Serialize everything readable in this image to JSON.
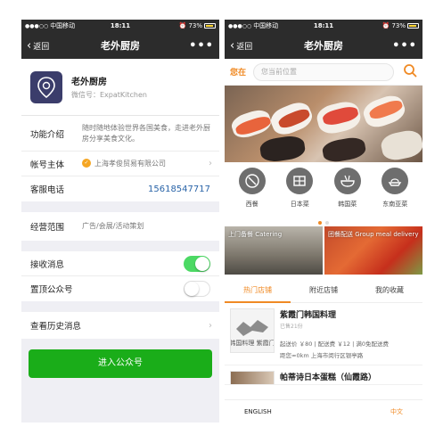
{
  "status": {
    "signal": "●●●○○",
    "carrier": "中国移动",
    "time": "18:11",
    "battery": "73%"
  },
  "left": {
    "nav": {
      "back": "返回",
      "title": "老外厨房",
      "more": "•••"
    },
    "profile": {
      "name": "老外厨房",
      "wechat_id": "微信号：ExpatKitchen"
    },
    "rows": {
      "intro_label": "功能介绍",
      "intro_value": "随时随地体验世界各国美食，走进老外厨房分享美食文化。",
      "owner_label": "帐号主体",
      "owner_value": "上海孝俊贸易有限公司",
      "phone_label": "客服电话",
      "phone_value": "15618547717",
      "scope_label": "经营范围",
      "scope_value": "广告/会展/活动策划",
      "receive_label": "接收消息",
      "receive_on": true,
      "pin_label": "置顶公众号",
      "pin_on": false,
      "history_label": "查看历史消息"
    },
    "enter_button": "进入公众号"
  },
  "right": {
    "nav": {
      "back": "返回",
      "title": "老外厨房",
      "more": "•••"
    },
    "location": {
      "label": "您在",
      "placeholder": "您当前位置"
    },
    "categories": [
      {
        "label": "西餐",
        "icon": "western-food-icon"
      },
      {
        "label": "日本菜",
        "icon": "japanese-food-icon"
      },
      {
        "label": "韩国菜",
        "icon": "korean-food-icon"
      },
      {
        "label": "东南亚菜",
        "icon": "southeast-asian-food-icon"
      }
    ],
    "promos": {
      "catering": "上门备餐 Catering",
      "group": "团餐配送 Group meal delivery"
    },
    "tabs": [
      "热门店铺",
      "附近店铺",
      "我的收藏"
    ],
    "stores": [
      {
        "name": "紫霞门韩国料理",
        "sales": "已售21份",
        "fee": "起送价 ￥80 | 配送费 ￥12 | 满0免配送费",
        "distance": "距您≈0km  上海市闵行区银亭路",
        "thumb_text": "韩国料理 紫霞门"
      },
      {
        "name": "帕蒂诗日本蛋糕（仙霞路）"
      }
    ],
    "bottom": {
      "english": "ENGLISH",
      "chinese": "中文"
    }
  }
}
